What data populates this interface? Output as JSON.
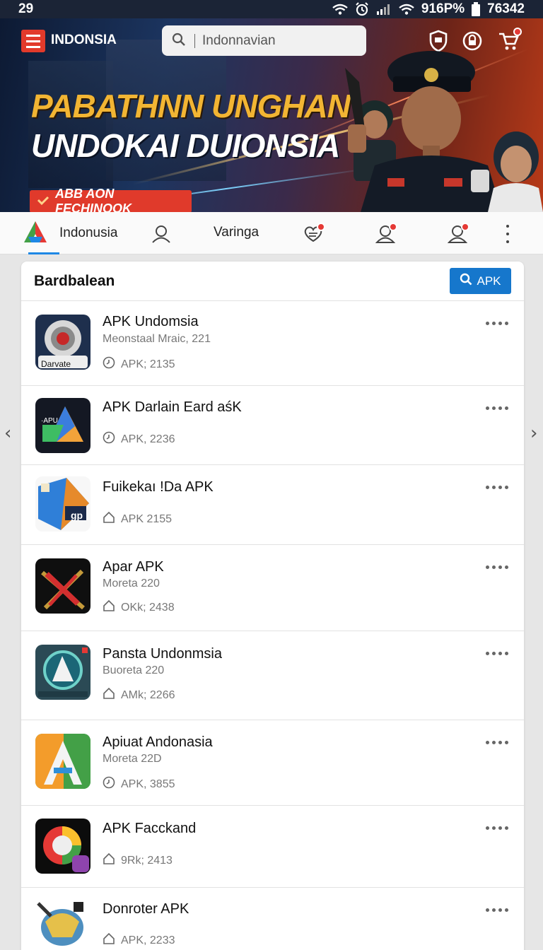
{
  "status_bar": {
    "time": "29",
    "right_text": "916P%",
    "battery_text": "76342"
  },
  "header": {
    "brand": "INDONSIA",
    "search_query": "Indonnavian",
    "headline_line1": "PABATHNN UNGHAN",
    "headline_line2": "UNDOKAI DUIONSIA",
    "cta_label": "ABB AON FECHINOOK",
    "colors": {
      "accent_red": "#e23a2b",
      "headline_gold": "#f2b533"
    }
  },
  "tabs": {
    "home_label": "Indonusia",
    "second_label": "Varinga",
    "icons": [
      "a-logo-icon",
      "user-icon",
      "heart-chat-icon",
      "user-alert-icon",
      "user-alert-icon",
      "more-vertical-icon"
    ]
  },
  "card": {
    "title": "Bardbalean",
    "button_label": "APK",
    "accent": "#1677cc"
  },
  "apps": [
    {
      "name": "APK Undomsia",
      "subtitle": "Meonstaal Mraic, 221",
      "meta": "APK; 2135",
      "icon_label": "Darvate",
      "meta_icon": "clock-icon"
    },
    {
      "name": "APK Darlain Eard aśK",
      "subtitle": "",
      "meta": "APK, 2236",
      "icon_label": "·APU",
      "meta_icon": "clock-icon"
    },
    {
      "name": "Fuikekaı !Da APK",
      "subtitle": "",
      "meta": "APK 2155",
      "icon_label": "gp",
      "meta_icon": "home-icon"
    },
    {
      "name": "Apar APK",
      "subtitle": "Moreta 220",
      "meta": "OKk; 2438",
      "icon_label": "",
      "meta_icon": "home-icon"
    },
    {
      "name": "Pansta Undonmsia",
      "subtitle": "Buoreta 220",
      "meta": "AMk; 2266",
      "icon_label": "",
      "meta_icon": "home-icon"
    },
    {
      "name": "Apiuat Andonasia",
      "subtitle": "Moreta 22D",
      "meta": "APK, 3855",
      "icon_label": "",
      "meta_icon": "clock-icon"
    },
    {
      "name": "APK Facckand",
      "subtitle": "",
      "meta": "9Rk; 2413",
      "icon_label": "",
      "meta_icon": "home-icon"
    },
    {
      "name": "Donroter APK",
      "subtitle": "",
      "meta": "APK, 2233",
      "icon_label": "",
      "meta_icon": "home-icon"
    }
  ]
}
